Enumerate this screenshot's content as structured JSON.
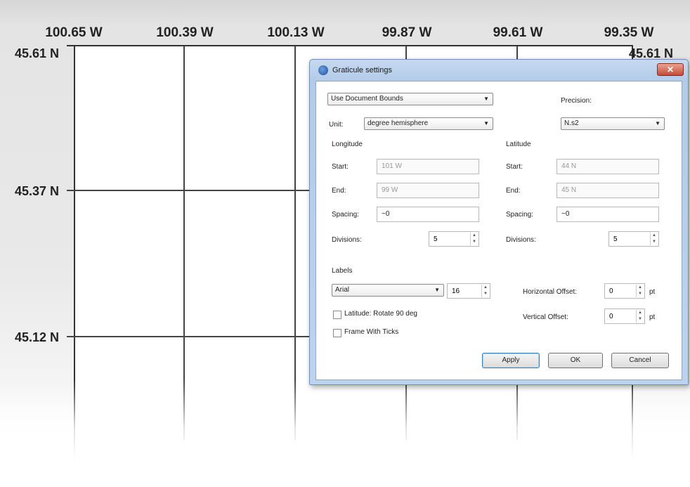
{
  "map": {
    "longitudes": [
      "100.65 W",
      "100.39 W",
      "100.13 W",
      "99.87 W",
      "99.61 W",
      "99.35 W"
    ],
    "latitudes": [
      "45.61 N",
      "45.37 N",
      "45.12 N"
    ],
    "right_latitude": "45.61 N"
  },
  "dialog": {
    "title": "Graticule settings",
    "close_glyph": "✕",
    "bounds_select": "Use Document Bounds",
    "precision_label": "Precision:",
    "precision_value": "N.s2",
    "unit_label": "Unit:",
    "unit_value": "degree hemisphere",
    "longitude": {
      "header": "Longitude",
      "start_label": "Start:",
      "start_value": "101 W",
      "end_label": "End:",
      "end_value": "99 W",
      "spacing_label": "Spacing:",
      "spacing_value": "~0",
      "divisions_label": "Divisions:",
      "divisions_value": "5"
    },
    "latitude": {
      "header": "Latitude",
      "start_label": "Start:",
      "start_value": "44 N",
      "end_label": "End:",
      "end_value": "45 N",
      "spacing_label": "Spacing:",
      "spacing_value": "~0",
      "divisions_label": "Divisions:",
      "divisions_value": "5"
    },
    "labels": {
      "header": "Labels",
      "font_value": "Arial",
      "size_value": "16",
      "horizontal_offset_label": "Horizontal Offset:",
      "horizontal_offset_value": "0",
      "vertical_offset_label": "Vertical Offset:",
      "vertical_offset_value": "0",
      "unit": "pt",
      "rotate_label": "Latitude: Rotate 90 deg",
      "frame_ticks_label": "Frame With Ticks"
    },
    "buttons": {
      "apply": "Apply",
      "ok": "OK",
      "cancel": "Cancel"
    }
  }
}
